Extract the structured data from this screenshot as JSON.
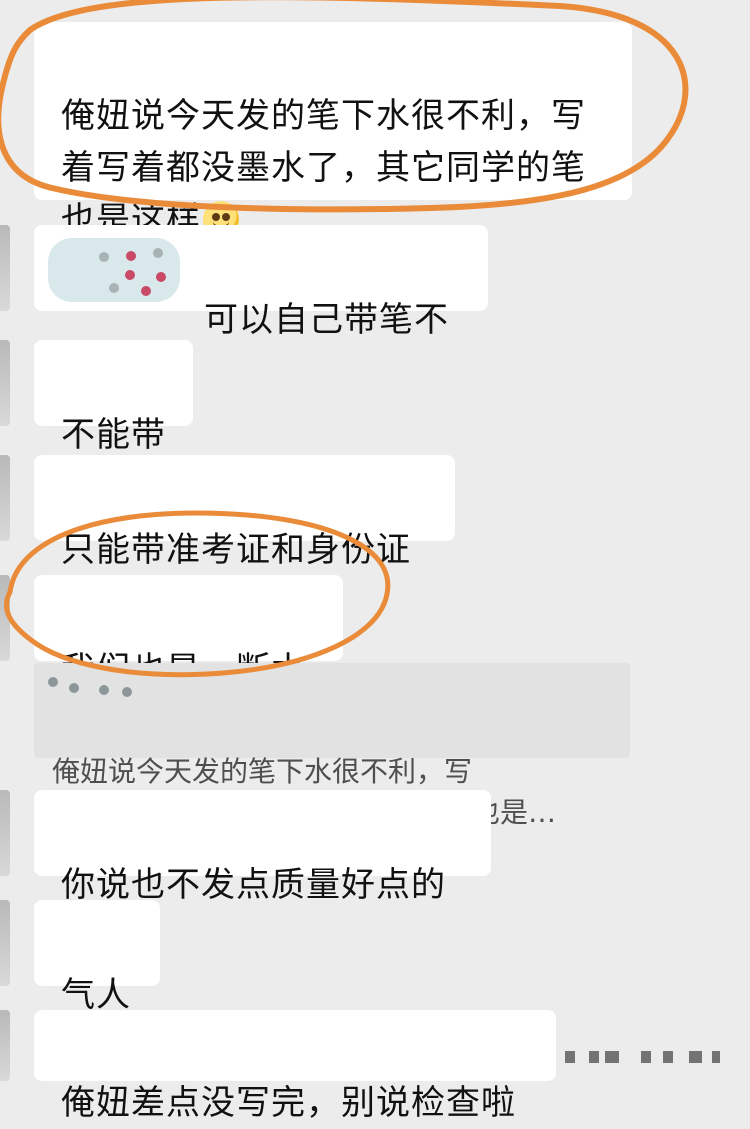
{
  "messages": [
    {
      "text": "俺妞说今天发的笔下水很不利，写\n着写着都没墨水了，其它同学的笔\n也是这样",
      "emoji": "face-palm-emoji"
    },
    {
      "text": "可以自己带笔不"
    },
    {
      "text": "不能带"
    },
    {
      "text": "只能带准考证和身份证"
    },
    {
      "text": "我们也是，断水"
    },
    {
      "quote_text": "俺妞说今天发的笔下水很不利，写\n着写着都没墨水了，其它同学的笔也是…"
    },
    {
      "text": "你说也不发点质量好点的"
    },
    {
      "text": "气人"
    },
    {
      "text": "俺妞差点没写完，别说检查啦"
    }
  ],
  "colors": {
    "background": "#ececec",
    "bubble": "#ffffff",
    "quote_background": "#e2e2e2",
    "highlight_circle": "#e98b39"
  },
  "icons": {
    "emoji": "face-palm-emoji"
  }
}
